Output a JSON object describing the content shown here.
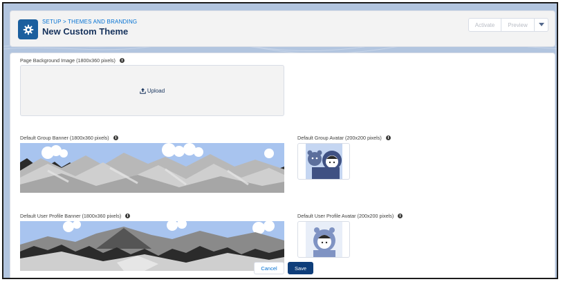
{
  "header": {
    "breadcrumb": "SETUP > THEMES AND BRANDING",
    "title": "New Custom Theme",
    "icon": "gear-icon",
    "buttons": {
      "activate": "Activate",
      "preview": "Preview",
      "menu_icon": "chevron-down-icon"
    }
  },
  "form": {
    "page_background": {
      "label": "Page Background Image (1800x360 pixels)",
      "upload_label": "Upload",
      "upload_icon": "upload-icon"
    },
    "group_banner": {
      "label": "Default Group Banner (1800x360 pixels)"
    },
    "group_avatar": {
      "label": "Default Group Avatar (200x200 pixels)"
    },
    "user_banner": {
      "label": "Default User Profile Banner (1800x360 pixels)"
    },
    "user_avatar": {
      "label": "Default User Profile Avatar (200x200 pixels)"
    }
  },
  "footer": {
    "cancel_label": "Cancel",
    "save_label": "Save"
  },
  "colors": {
    "brand": "#1b5f9e",
    "link": "#0070d2",
    "save": "#0f3e7a",
    "sky": "#a9c3ef"
  }
}
